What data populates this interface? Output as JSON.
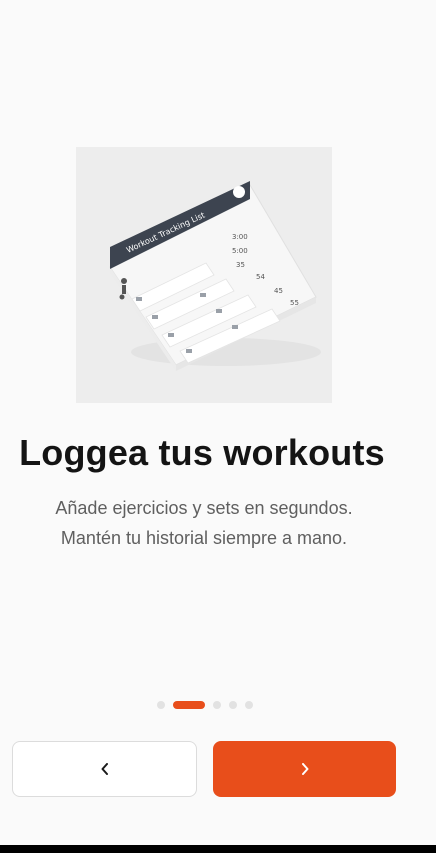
{
  "onboarding": {
    "title": "Loggea tus workouts",
    "subtitle_line1": "Añade ejercicios y sets en segundos.",
    "subtitle_line2": "Mantén tu historial siempre a mano.",
    "pagination": {
      "total": 5,
      "current": 2
    },
    "illustration": {
      "card_title": "Workout Tracking List",
      "header_label": "Workout",
      "values": [
        "3:00",
        "5:00",
        "35",
        "54",
        "45",
        "55"
      ]
    },
    "back_icon": "chevron-left-icon",
    "next_icon": "chevron-right-icon"
  },
  "colors": {
    "accent": "#e84e1b",
    "background": "#fafafa",
    "title": "#141414",
    "subtitle": "#5f5f5f",
    "dot_inactive": "#e2e2e2",
    "card_header": "#3d4450"
  }
}
